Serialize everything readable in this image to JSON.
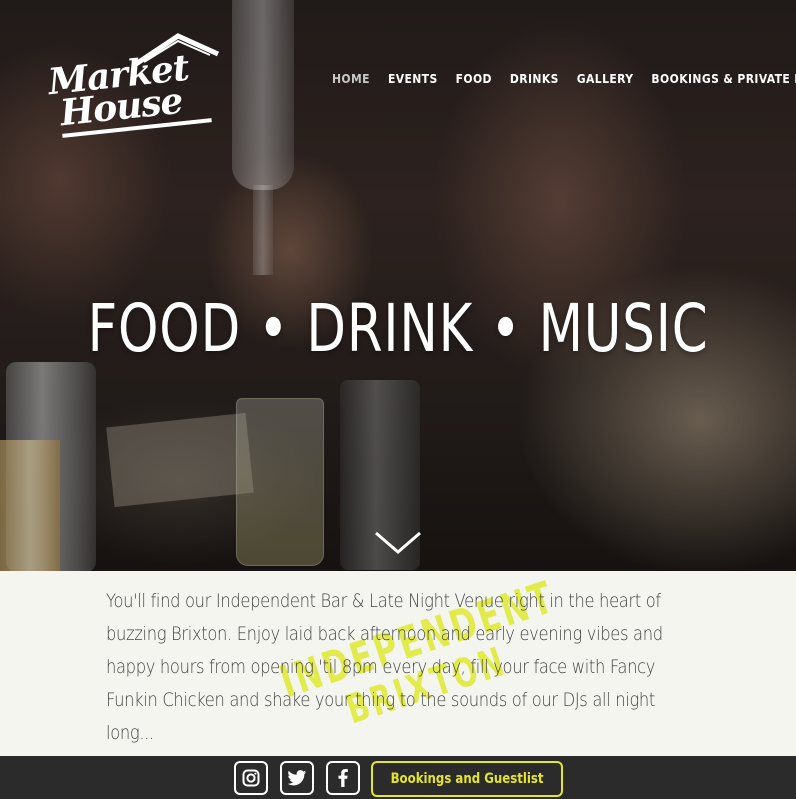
{
  "brand": {
    "line1": "Market",
    "line2": "House"
  },
  "nav": {
    "items": [
      {
        "label": "HOME"
      },
      {
        "label": "EVENTS"
      },
      {
        "label": "FOOD"
      },
      {
        "label": "DRINKS"
      },
      {
        "label": "GALLERY"
      },
      {
        "label": "BOOKINGS & PRIVATE HIRE"
      }
    ],
    "active": "HOME"
  },
  "hero": {
    "headline": "FOOD • DRINK • MUSIC"
  },
  "intro": {
    "text": "You'll find our Independent Bar & Late Night Venue right in the heart of buzzing Brixton. Enjoy laid back afternoon and early evening vibes and happy hours from opening 'til 8pm every day, fill your face with Fancy Funkin Chicken and shake your thing to the sounds of our DJs all night long...",
    "stamp_line1": "INDEPENDENT",
    "stamp_line2": "BRIXTON"
  },
  "footer": {
    "social": [
      {
        "icon": "instagram-icon"
      },
      {
        "icon": "twitter-icon"
      },
      {
        "icon": "facebook-icon"
      }
    ],
    "booking_label": "Bookings and Guestlist"
  },
  "colors": {
    "accent": "#e5e52a",
    "bar": "#2b2b2b",
    "background": "#f5f5f0"
  }
}
